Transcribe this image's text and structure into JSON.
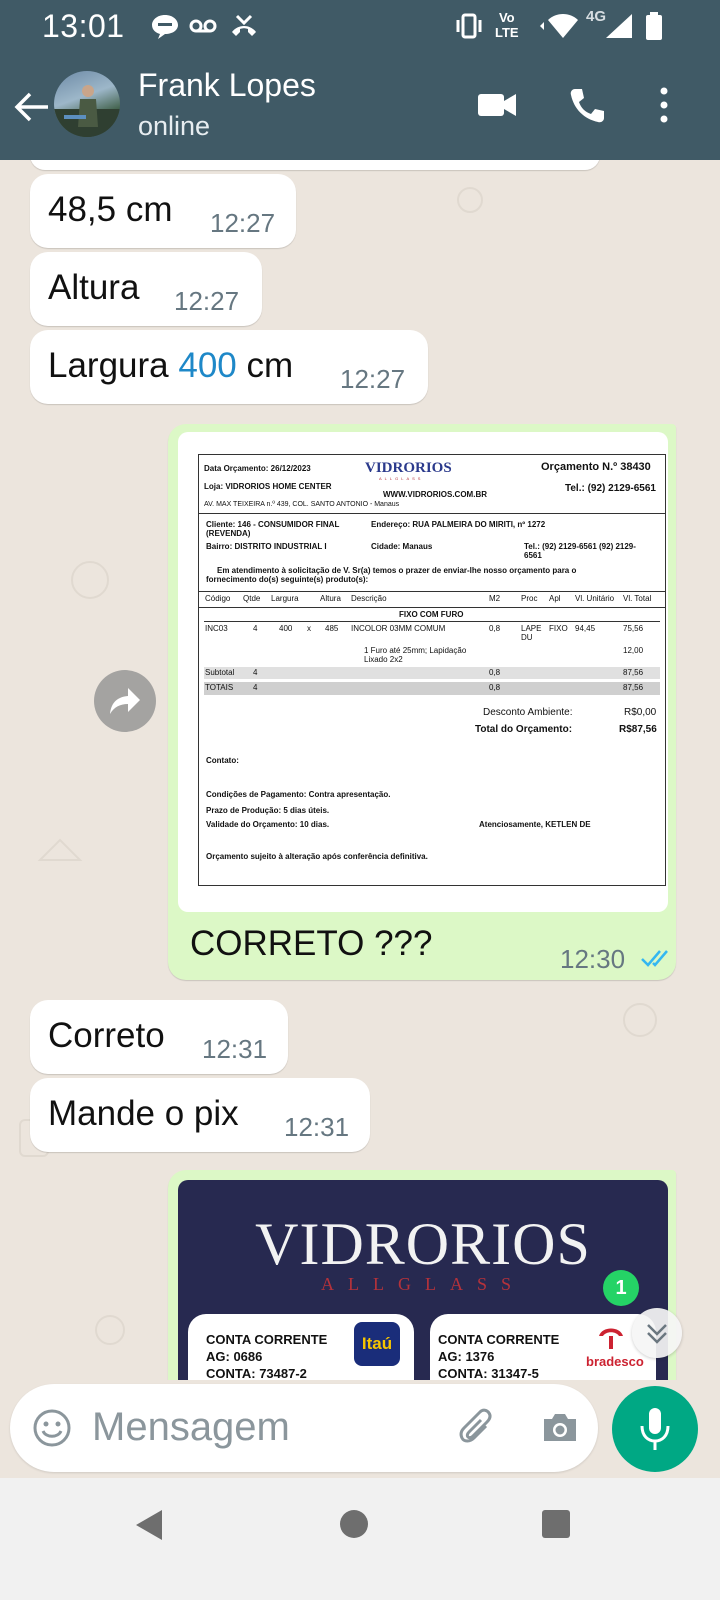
{
  "status_bar": {
    "time": "13:01",
    "network_label_top": "Vo",
    "network_label_bottom": "LTE",
    "network_type": "4G",
    "icons": [
      "chat-bubble-icon",
      "voicemail-icon",
      "missed-call-icon",
      "vibrate-icon",
      "wifi-icon",
      "signal-icon",
      "battery-icon"
    ]
  },
  "header": {
    "contact_name": "Frank Lopes",
    "contact_status": "online",
    "icons": [
      "back-arrow-icon",
      "video-call-icon",
      "phone-icon",
      "more-vert-icon"
    ]
  },
  "messages": [
    {
      "direction": "in",
      "text": "48,5 cm",
      "time": "12:27"
    },
    {
      "direction": "in",
      "text_parts": [
        "Largura",
        "400",
        "cm"
      ],
      "time": "12:27",
      "label_only": "Altura"
    },
    {
      "direction": "out",
      "caption": "CORRETO ???",
      "time": "12:30",
      "status": "read"
    },
    {
      "direction": "in",
      "text": "Correto",
      "time": "12:31"
    },
    {
      "direction": "in",
      "text": "Mande o pix",
      "time": "12:31"
    }
  ],
  "msg_altura": {
    "text": "Altura",
    "time": "12:27"
  },
  "msg_largura": {
    "prefix": "Largura",
    "number": "400",
    "suffix": "cm",
    "time": "12:27"
  },
  "quote": {
    "date": "Data Orçamento: 26/12/2023",
    "logo": "VIDRORIOS",
    "logo_sub": "ALLGLASS",
    "number": "Orçamento N.º 38430",
    "store": "Loja: VIDRORIOS HOME CENTER",
    "website": "WWW.VIDRORIOS.COM.BR",
    "phone": "Tel.: (92) 2129-6561",
    "address": "AV. MAX TEIXEIRA  n.º 439, COL. SANTO ANTONIO - Manaus",
    "client": "Cliente: 146 - CONSUMIDOR FINAL",
    "client_2": "(REVENDA)",
    "client_address": "Endereço: RUA PALMEIRA DO MIRITI, nº 1272",
    "district": "Bairro: DISTRITO INDUSTRIAL I",
    "city": "Cidade: Manaus",
    "client_phone": "Tel.: (92) 2129-6561  (92) 2129-",
    "client_phone_2": "6561",
    "intro": "Em atendimento à solicitação de V. Sr(a) temos o prazer de enviar-lhe nosso orçamento para o",
    "intro_2": "fornecimento do(s) seguinte(s) produto(s):",
    "columns": [
      "Código",
      "Qtde",
      "Largura",
      "Altura",
      "Descrição",
      "M2",
      "Proc",
      "Apl",
      "Vl. Unitário",
      "Vl. Total"
    ],
    "section": "FIXO COM FURO",
    "item": {
      "code": "INC03",
      "qty": "4",
      "width": "400",
      "x": "x",
      "height": "485",
      "desc": "INCOLOR 03MM COMUM",
      "m2": "0,8",
      "proc": "LAPE",
      "proc_2": "DU",
      "apl": "FIXO",
      "unit": "94,45",
      "total": "75,56"
    },
    "extra": {
      "desc": "1 Furo até 25mm; Lapidação",
      "desc_2": "Lixado 2x2",
      "total": "12,00"
    },
    "subtotal": {
      "label": "Subtotal",
      "qty": "4",
      "m2": "0,8",
      "total": "87,56"
    },
    "totals": {
      "label": "TOTAIS",
      "qty": "4",
      "m2": "0,8",
      "total": "87,56"
    },
    "discount_label": "Desconto Ambiente:",
    "discount_value": "R$0,00",
    "total_label": "Total do Orçamento:",
    "total_value": "R$87,56",
    "contact": "Contato:",
    "payment": "Condições de Pagamento: Contra apresentação.",
    "production": "Prazo de Produção:  5 dias úteis.",
    "validity": "Validade do Orçamento:  10 dias.",
    "signature": "Atenciosamente, KETLEN DE",
    "disclaimer": "Orçamento sujeito à alteração após conferência definitiva."
  },
  "bank_card": {
    "title": "VIDRORIOS",
    "subtitle": "ALLGLASS",
    "accounts": [
      {
        "label": "CONTA CORRENTE",
        "agency": "AG: 0686",
        "account": "CONTA: 73487-2",
        "bank": "Itaú"
      },
      {
        "label": "CONTA CORRENTE",
        "agency": "AG: 1376",
        "account": "CONTA: 31347-5",
        "bank": "bradesco"
      }
    ]
  },
  "unread_badge": "1",
  "input": {
    "placeholder": "Mensagem"
  },
  "colors": {
    "header": "#405a66",
    "outgoing": "#dcf8c6",
    "accent": "#00a884",
    "read_ticks": "#34b7f1"
  }
}
